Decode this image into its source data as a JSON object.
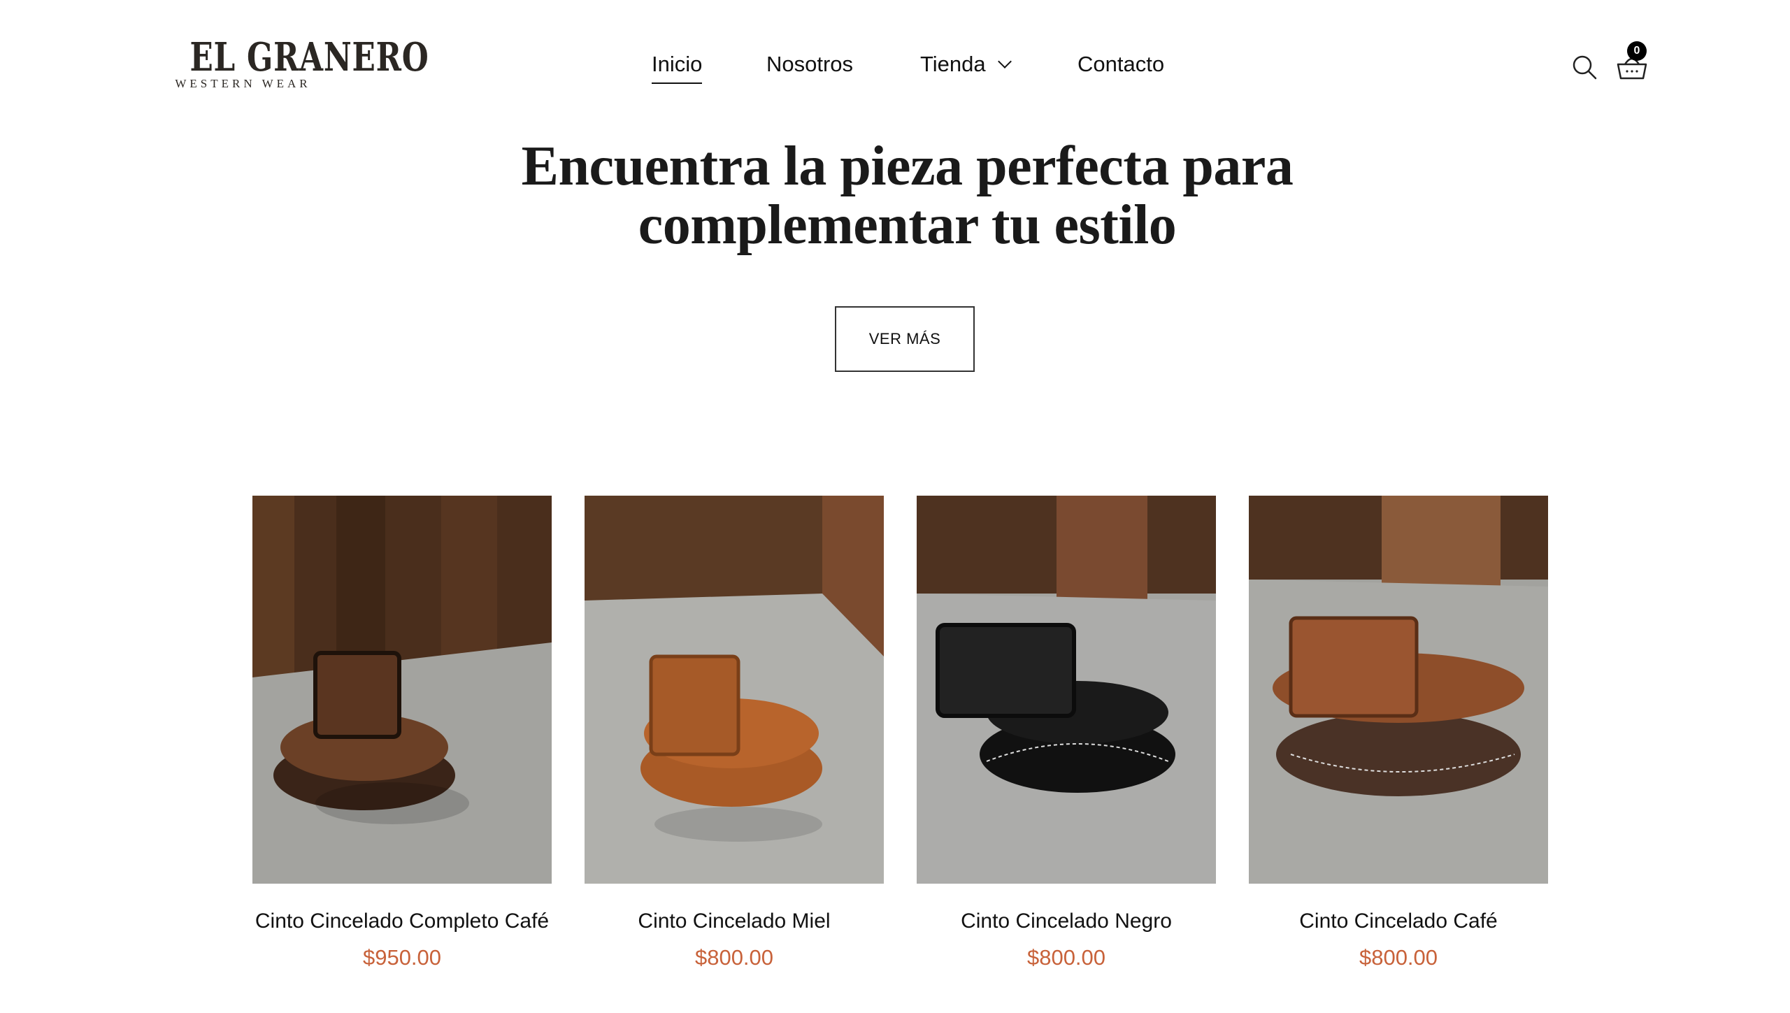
{
  "brand": {
    "name": "EL GRANERO",
    "tagline": "WESTERN WEAR"
  },
  "nav": {
    "items": [
      {
        "label": "Inicio",
        "active": true
      },
      {
        "label": "Nosotros",
        "active": false
      },
      {
        "label": "Tienda",
        "active": false,
        "has_dropdown": true
      },
      {
        "label": "Contacto",
        "active": false
      }
    ]
  },
  "header_icons": {
    "search": "search-icon",
    "cart": "shopping-basket-icon",
    "cart_count": "0"
  },
  "hero": {
    "title_line1": "Encuentra la pieza perfecta para",
    "title_line2": "complementar tu estilo",
    "cta_label": "VER MÁS"
  },
  "products": [
    {
      "name": "Cinto Cincelado Completo Café",
      "price": "$950.00",
      "leather_color": "#6b4026"
    },
    {
      "name": "Cinto Cincelado Miel",
      "price": "$800.00",
      "leather_color": "#b8642c"
    },
    {
      "name": "Cinto Cincelado Negro",
      "price": "$800.00",
      "leather_color": "#1a1a1a"
    },
    {
      "name": "Cinto Cincelado Café",
      "price": "$800.00",
      "leather_color": "#8e4e2a"
    }
  ],
  "colors": {
    "price": "#c8623a",
    "text": "#111111",
    "background": "#ffffff"
  }
}
